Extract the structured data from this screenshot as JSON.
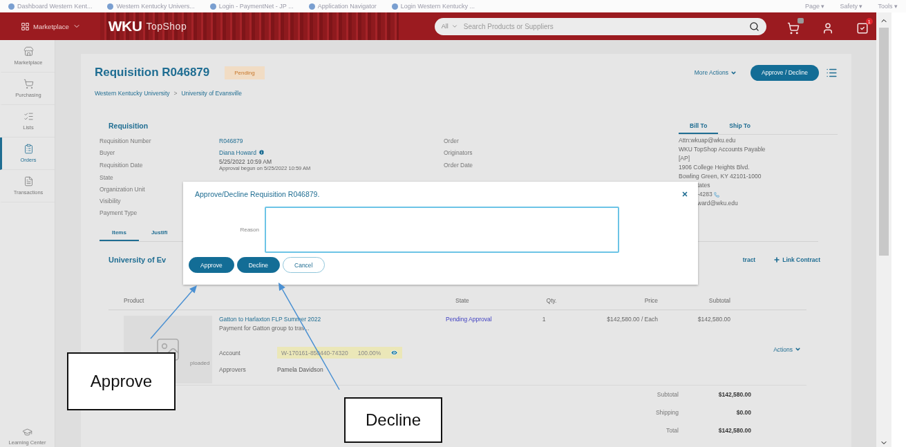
{
  "browser_bar": {
    "tabs": [
      "Dashboard Western Kent...",
      "Western Kentucky Univers...",
      "Login - PaymentNet - JP ...",
      "Application Navigator",
      "Login Western Kentucky ..."
    ],
    "menus": [
      "Page ▾",
      "Safety ▾",
      "Tools ▾"
    ]
  },
  "header": {
    "menu": "Marketplace",
    "logo": "WKU",
    "logo_sub": "TopShop",
    "search_scope": "All",
    "search_placeholder": "Search Products or Suppliers",
    "notification_badge": "1"
  },
  "sidebar": {
    "items": [
      {
        "label": "Marketplace",
        "selected": false
      },
      {
        "label": "Purchasing",
        "selected": false
      },
      {
        "label": "Lists",
        "selected": false
      },
      {
        "label": "Orders",
        "selected": true
      },
      {
        "label": "Transactions",
        "selected": false
      }
    ],
    "footer": "Learning Center"
  },
  "requisition": {
    "title": "Requisition R046879",
    "status": "Pending",
    "more_actions": "More Actions",
    "approve_decline": "Approve / Decline",
    "breadcrumb": [
      "Western Kentucky University",
      "University of Evansville"
    ],
    "breadcrumb_separator": ">",
    "section_title": "Requisition",
    "fields": [
      {
        "label": "Requisition Number",
        "value": "R046879",
        "kind": "link",
        "label2": "Order"
      },
      {
        "label": "Buyer",
        "value": "Diana Howard",
        "kind": "person",
        "label2": "Originators"
      },
      {
        "label": "Requisition Date",
        "value": "5/25/2022 10:59 AM",
        "note": "Approval begun on 5/25/2022 10:59 AM",
        "kind": "text",
        "label2": "Order Date"
      },
      {
        "label": "State"
      },
      {
        "label": "Organization Unit"
      },
      {
        "label": "Visibility"
      },
      {
        "label": "Payment Type"
      }
    ],
    "address_tabs": [
      {
        "label": "Bill To",
        "selected": true
      },
      {
        "label": "Ship To",
        "selected": false
      }
    ],
    "address_lines": [
      "Attn:wkuap@wku.edu",
      "WKU TopShop Accounts Payable",
      "[AP]",
      "1906 College Heights Blvd.",
      "Bowling Green, KY 42101-1000"
    ],
    "address_partial_lines": [
      {
        "text": "tates",
        "kind": "text"
      },
      {
        "text": "-4283",
        "kind": "phone"
      },
      {
        "text": "ward@wku.edu",
        "kind": "text"
      }
    ],
    "tabs": [
      {
        "label": "Items",
        "selected": true
      },
      {
        "label": "Justifi",
        "selected": false
      }
    ],
    "supplier": "University of Ev",
    "contract_link_partial": "tract",
    "link_contract": "Link Contract",
    "table": {
      "columns": [
        "Product",
        "State",
        "Qty.",
        "Price",
        "Subtotal"
      ],
      "rows": [
        {
          "name": "Gatton to Harlaxton FLP Summer 2022",
          "description": "Payment for Gatton group to trav...",
          "image_caption": "ploaded",
          "state": "Pending Approval",
          "qty": "1",
          "price": "$142,580.00 / Each",
          "subtotal": "$142,580.00",
          "account_label": "Account",
          "account": "W-170161-850440-74320",
          "account_share": "100.00%",
          "approvers_label": "Approvers",
          "approvers": "Pamela Davidson",
          "actions": "Actions"
        }
      ]
    },
    "totals": [
      {
        "label": "Subtotal",
        "value": "$142,580.00"
      },
      {
        "label": "Shipping",
        "value": "$0.00"
      },
      {
        "label": "Total",
        "value": "$142,580.00"
      }
    ]
  },
  "dialog": {
    "title": "Approve/Decline Requisition R046879.",
    "reason_label": "Reason",
    "buttons": [
      {
        "label": "Approve",
        "kind": "primary"
      },
      {
        "label": "Decline",
        "kind": "primary"
      },
      {
        "label": "Cancel",
        "kind": "secondary"
      }
    ]
  },
  "callouts": [
    {
      "text": "Approve"
    },
    {
      "text": "Decline"
    }
  ]
}
